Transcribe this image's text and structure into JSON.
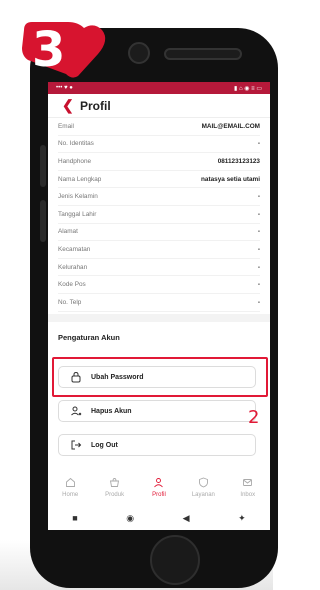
{
  "step_badge": {
    "number": "3"
  },
  "status_bar": {
    "left": "••• ♥ ●",
    "right": "▮ ⌂ ◉ ≡ ▭"
  },
  "header": {
    "title": "Profil"
  },
  "profile_rows": [
    {
      "label": "Email",
      "value": "MAIL@EMAIL.COM"
    },
    {
      "label": "No. Identitas",
      "value": "-"
    },
    {
      "label": "Handphone",
      "value": "081123123123"
    },
    {
      "label": "Nama Lengkap",
      "value": "natasya setia utami"
    },
    {
      "label": "Jenis Kelamin",
      "value": "-"
    },
    {
      "label": "Tanggal Lahir",
      "value": "-"
    },
    {
      "label": "Alamat",
      "value": "-"
    },
    {
      "label": "Kecamatan",
      "value": "-"
    },
    {
      "label": "Kelurahan",
      "value": "-"
    },
    {
      "label": "Kode Pos",
      "value": "-"
    },
    {
      "label": "No. Telp",
      "value": "-"
    }
  ],
  "account_settings": {
    "title": "Pengaturan Akun",
    "change_password": "Ubah Password",
    "delete_account": "Hapus Akun",
    "logout": "Log Out"
  },
  "annotation": {
    "step": "2"
  },
  "bottom_nav": [
    {
      "label": "Home",
      "icon": "home-icon"
    },
    {
      "label": "Produk",
      "icon": "bag-icon"
    },
    {
      "label": "Profil",
      "icon": "user-icon"
    },
    {
      "label": "Layanan",
      "icon": "shield-icon"
    },
    {
      "label": "Inbox",
      "icon": "mail-icon"
    }
  ],
  "active_nav": "Profil",
  "colors": {
    "accent": "#e11936",
    "status_bar": "#b5193a"
  }
}
